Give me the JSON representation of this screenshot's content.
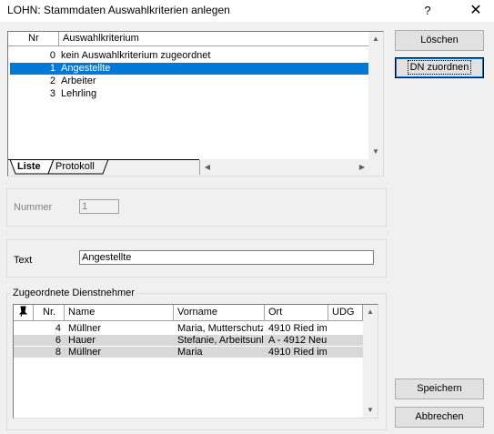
{
  "window": {
    "title": "LOHN: Stammdaten Auswahlkriterien anlegen",
    "help_label": "?",
    "close_label": "✕"
  },
  "buttons": {
    "delete": "Löschen",
    "assign": "DN zuordnen",
    "save": "Speichern",
    "cancel": "Abbrechen"
  },
  "criteria_list": {
    "columns": [
      "Nr",
      "Auswahlkriterium"
    ],
    "rows": [
      {
        "nr": "0",
        "text": "kein Auswahlkriterium zugeordnet"
      },
      {
        "nr": "1",
        "text": "Angestellte"
      },
      {
        "nr": "2",
        "text": "Arbeiter"
      },
      {
        "nr": "3",
        "text": "Lehrling"
      }
    ],
    "selected_index": 1
  },
  "tabs": [
    "Liste",
    "Protokoll"
  ],
  "form": {
    "nummer_label": "Nummer",
    "nummer_value": "1",
    "text_label": "Text",
    "text_value": "Angestellte"
  },
  "employees": {
    "group_title": "Zugeordnete Dienstnehmer",
    "columns": [
      "Nr.",
      "Name",
      "Vorname",
      "Ort",
      "UDG"
    ],
    "rows": [
      {
        "nr": "4",
        "name": "Müllner",
        "vorname": "Maria, Mutterschutz",
        "ort": "4910 Ried im"
      },
      {
        "nr": "6",
        "name": "Hauer",
        "vorname": "Stefanie, Arbeitsunl",
        "ort": "A - 4912 Neu"
      },
      {
        "nr": "8",
        "name": "Müllner",
        "vorname": "Maria",
        "ort": "4910 Ried im"
      }
    ]
  },
  "scroll_glyphs": {
    "up": "▲",
    "down": "▼",
    "left": "◀",
    "right": "▶"
  }
}
